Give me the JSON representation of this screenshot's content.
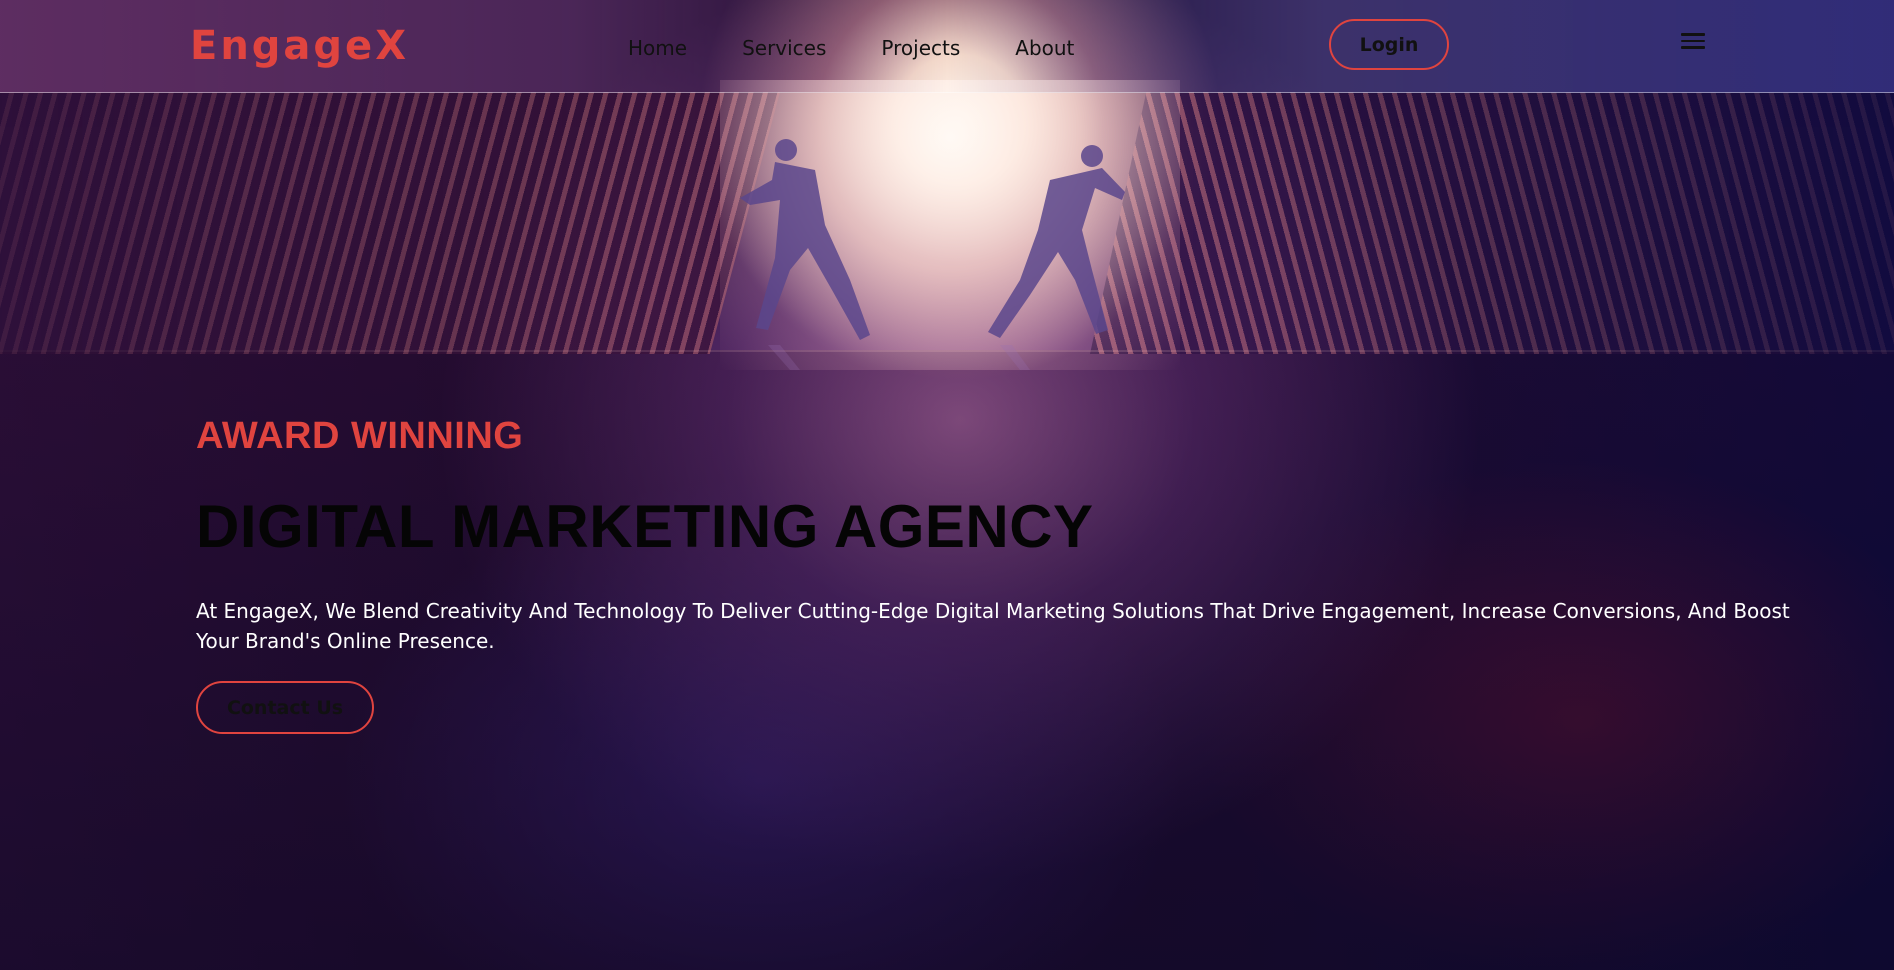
{
  "brand": {
    "name": "EngageX",
    "accent_color": "#e0443f"
  },
  "nav": {
    "links": [
      {
        "label": "Home"
      },
      {
        "label": "Services"
      },
      {
        "label": "Projects"
      },
      {
        "label": "About"
      }
    ],
    "login_label": "Login",
    "menu_icon": "hamburger-menu-icon"
  },
  "hero": {
    "eyebrow": "AWARD WINNING",
    "headline": "DIGITAL MARKETING AGENCY",
    "description": "At EngageX, We Blend Creativity And Technology To Deliver Cutting-Edge Digital Marketing Solutions That Drive Engagement, Increase Conversions, And Boost Your Brand's Online Presence.",
    "cta_label": "Contact Us",
    "background_image": "two workers pushing open large sliding doors toward bright light"
  }
}
